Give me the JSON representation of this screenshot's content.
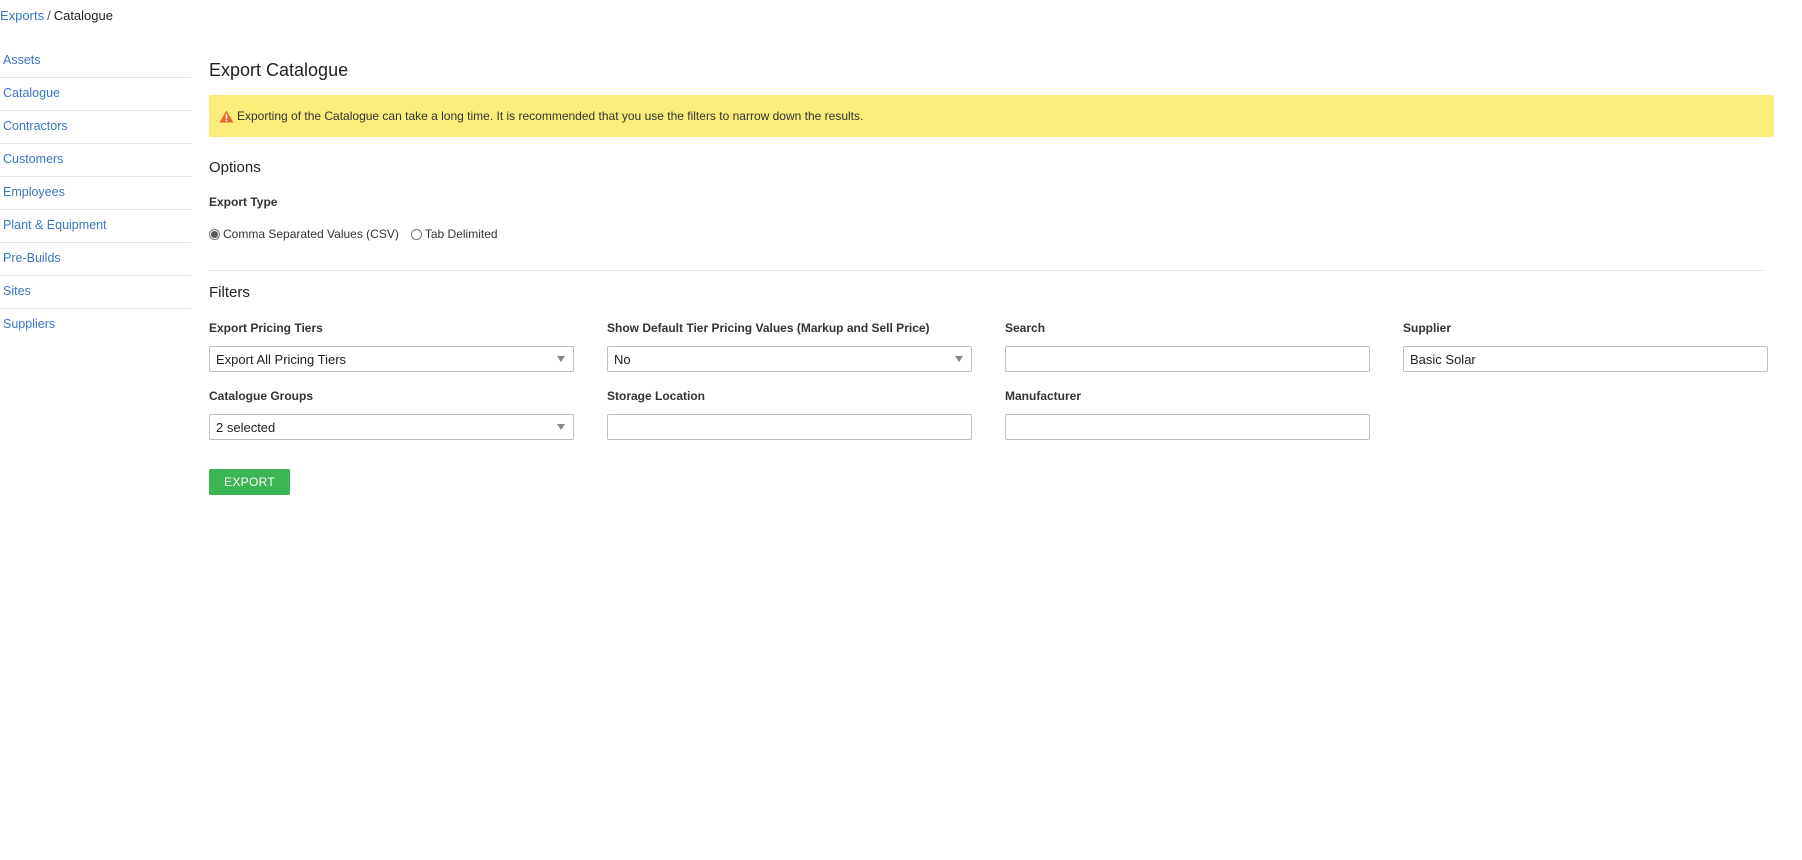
{
  "breadcrumb": {
    "link": "Exports",
    "separator": "/",
    "current": "Catalogue"
  },
  "sidebar": {
    "items": [
      {
        "label": "Assets"
      },
      {
        "label": "Catalogue"
      },
      {
        "label": "Contractors"
      },
      {
        "label": "Customers"
      },
      {
        "label": "Employees"
      },
      {
        "label": "Plant & Equipment"
      },
      {
        "label": "Pre-Builds"
      },
      {
        "label": "Sites"
      },
      {
        "label": "Suppliers"
      }
    ]
  },
  "main": {
    "title": "Export Catalogue",
    "alert": {
      "icon": "warning-triangle-icon",
      "text": "Exporting of the Catalogue can take a long time. It is recommended that you use the filters to narrow down the results.",
      "background": "#fced7a"
    },
    "options": {
      "title": "Options",
      "export_type_label": "Export Type",
      "export_types": [
        {
          "label": "Comma Separated Values (CSV)",
          "selected": true
        },
        {
          "label": "Tab Delimited",
          "selected": false
        }
      ]
    },
    "filters": {
      "title": "Filters",
      "export_pricing_tiers": {
        "label": "Export Pricing Tiers",
        "value": "Export All Pricing Tiers"
      },
      "show_default_tier": {
        "label": "Show Default Tier Pricing Values (Markup and Sell Price)",
        "value": "No"
      },
      "search": {
        "label": "Search",
        "value": ""
      },
      "supplier": {
        "label": "Supplier",
        "value": "Basic Solar"
      },
      "catalogue_groups": {
        "label": "Catalogue Groups",
        "value": "2 selected"
      },
      "storage_location": {
        "label": "Storage Location",
        "value": ""
      },
      "manufacturer": {
        "label": "Manufacturer",
        "value": ""
      }
    },
    "export_button": {
      "label": "EXPORT",
      "color": "#3cb554"
    }
  },
  "colors": {
    "link": "#3a76c4"
  }
}
